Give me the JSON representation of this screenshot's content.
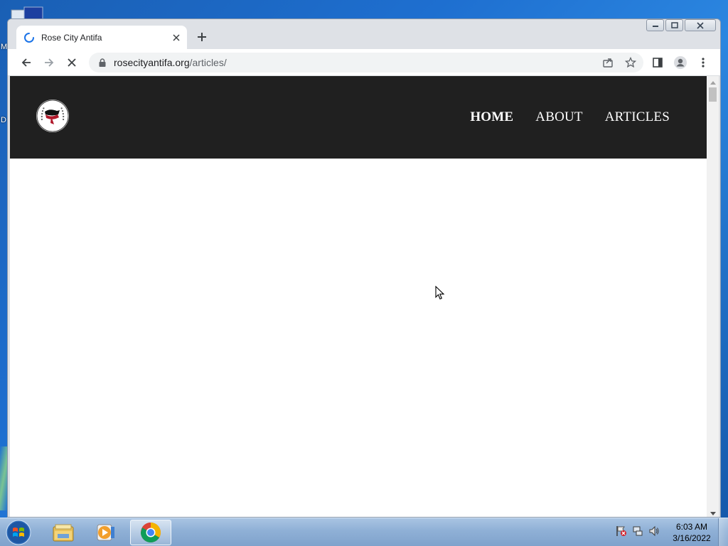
{
  "desktop": {
    "icon_letters": [
      "M",
      "D"
    ]
  },
  "browser": {
    "tab": {
      "title": "Rose City Antifa",
      "close_icon": "close-icon"
    },
    "new_tab_icon": "plus-icon",
    "window_controls": [
      "minimize-icon",
      "restore-icon",
      "close-icon"
    ],
    "toolbar": {
      "back_icon": "arrow-left-icon",
      "forward_icon": "arrow-right-icon",
      "stop_icon": "stop-loading-icon",
      "url_host": "rosecityantifa.org",
      "url_path": "/articles/",
      "share_icon": "share-icon",
      "bookmark_icon": "star-icon",
      "side_panel_icon": "side-panel-icon",
      "profile_icon": "profile-icon",
      "menu_icon": "more-vert-icon"
    }
  },
  "site": {
    "nav": [
      {
        "label": "HOME",
        "active": true
      },
      {
        "label": "ABOUT",
        "active": false
      },
      {
        "label": "ARTICLES",
        "active": false
      }
    ],
    "header_bg": "#202020"
  },
  "taskbar": {
    "apps": [
      "file-explorer-icon",
      "media-player-icon",
      "chrome-icon"
    ],
    "tray": [
      "action-center-flag-icon",
      "network-icon",
      "volume-icon"
    ],
    "time": "6:03 AM",
    "date": "3/16/2022"
  }
}
